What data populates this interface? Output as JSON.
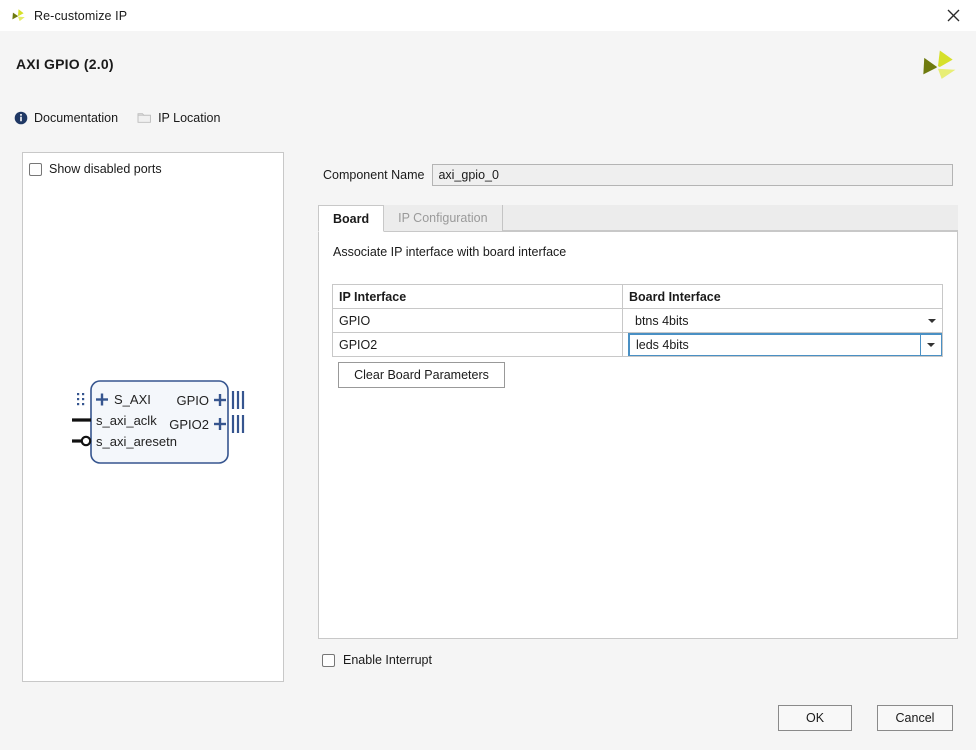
{
  "window": {
    "title": "Re-customize IP",
    "icon": "xilinx-logo-icon",
    "close_label": "✕"
  },
  "header": {
    "ip_title": "AXI GPIO (2.0)",
    "brand_logo": "xilinx-logo-icon"
  },
  "links": [
    {
      "label": "Documentation",
      "icon": "info-icon"
    },
    {
      "label": "IP Location",
      "icon": "folder-icon"
    }
  ],
  "preview": {
    "show_disabled_ports_label": "Show disabled ports",
    "show_disabled_ports_checked": false,
    "block": {
      "left_ports": [
        {
          "name": "S_AXI",
          "type": "bus"
        },
        {
          "name": "s_axi_aclk",
          "type": "clock"
        },
        {
          "name": "s_axi_aresetn",
          "type": "reset"
        }
      ],
      "right_ports": [
        {
          "name": "GPIO",
          "type": "bus"
        },
        {
          "name": "GPIO2",
          "type": "bus"
        }
      ]
    }
  },
  "component": {
    "name_label": "Component Name",
    "name_value": "axi_gpio_0"
  },
  "tabs": [
    {
      "label": "Board",
      "active": true
    },
    {
      "label": "IP Configuration",
      "active": false
    }
  ],
  "board_tab": {
    "assoc_label": "Associate IP interface with board interface",
    "table": {
      "headers": [
        "IP Interface",
        "Board Interface"
      ],
      "rows": [
        {
          "ip_interface": "GPIO",
          "board_interface": "btns 4bits",
          "focused": false
        },
        {
          "ip_interface": "GPIO2",
          "board_interface": "leds 4bits",
          "focused": true
        }
      ]
    },
    "clear_button_label": "Clear Board Parameters"
  },
  "options": {
    "enable_interrupt_label": "Enable Interrupt",
    "enable_interrupt_checked": false
  },
  "footer": {
    "ok_label": "OK",
    "cancel_label": "Cancel"
  },
  "colors": {
    "dialog_bg": "#f5f5f5",
    "panel_bg": "#ffffff",
    "border": "#c8c8c8",
    "focus_blue": "#4a90c4",
    "block_line": "#36558f",
    "block_fill": "#f4f7fb",
    "logo_dark": "#6e7a0e",
    "logo_light": "#d6e02a",
    "info_icon": "#1f3864"
  }
}
